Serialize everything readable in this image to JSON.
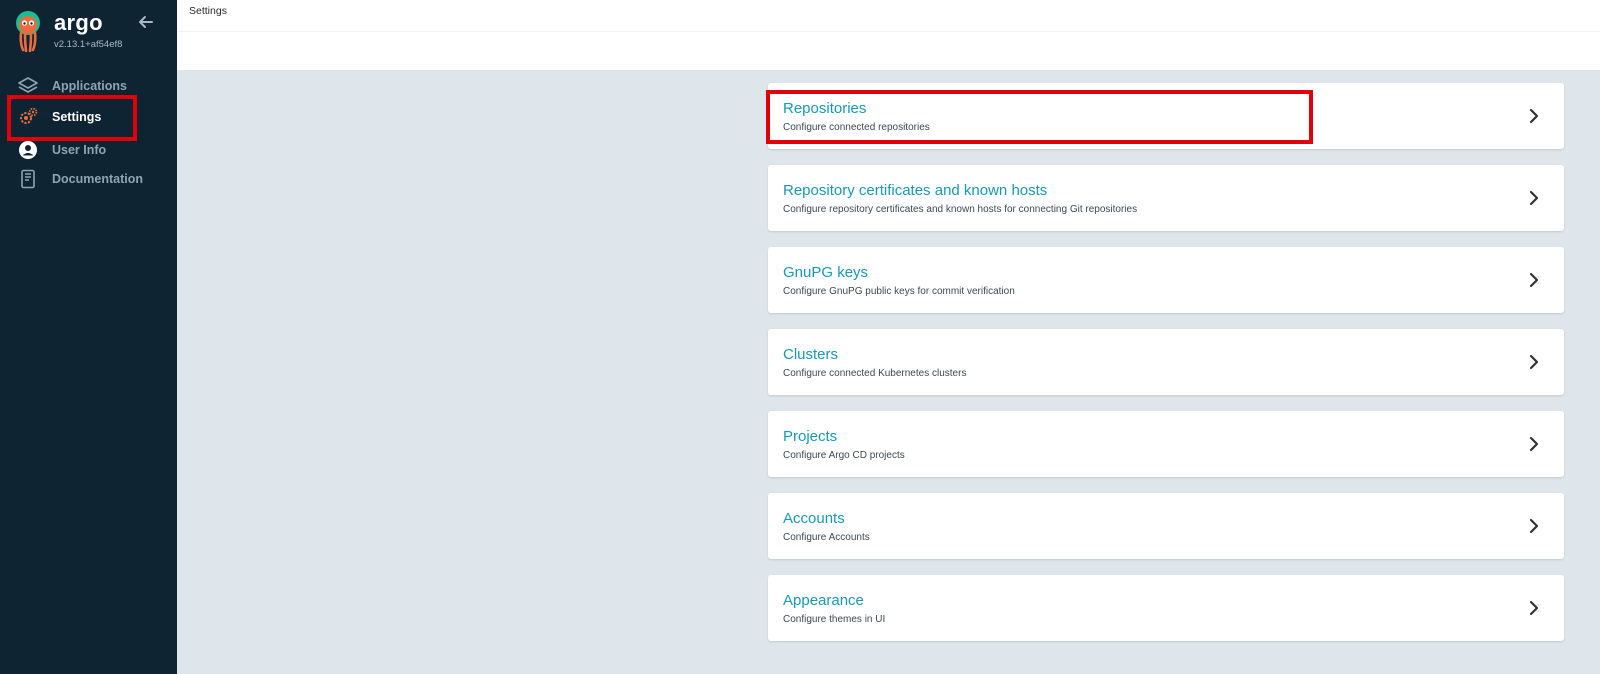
{
  "app": {
    "brand": "argo",
    "version": "v2.13.1+af54ef8"
  },
  "sidebar": {
    "items": [
      {
        "label": "Applications",
        "icon": "layers-icon",
        "active": false
      },
      {
        "label": "Settings",
        "icon": "gears-icon",
        "active": true
      },
      {
        "label": "User Info",
        "icon": "user-circle-icon",
        "active": false
      },
      {
        "label": "Documentation",
        "icon": "book-icon",
        "active": false
      }
    ]
  },
  "header": {
    "title": "Settings"
  },
  "settings": {
    "cards": [
      {
        "title": "Repositories",
        "description": "Configure connected repositories"
      },
      {
        "title": "Repository certificates and known hosts",
        "description": "Configure repository certificates and known hosts for connecting Git repositories"
      },
      {
        "title": "GnuPG keys",
        "description": "Configure GnuPG public keys for commit verification"
      },
      {
        "title": "Clusters",
        "description": "Configure connected Kubernetes clusters"
      },
      {
        "title": "Projects",
        "description": "Configure Argo CD projects"
      },
      {
        "title": "Accounts",
        "description": "Configure Accounts"
      },
      {
        "title": "Appearance",
        "description": "Configure themes in UI"
      }
    ]
  },
  "colors": {
    "sidebar_bg": "#0e2433",
    "accent_link": "#189ab4",
    "content_bg": "#dee6eb",
    "highlight": "#e0000a",
    "settings_icon": "#e96d3f"
  }
}
